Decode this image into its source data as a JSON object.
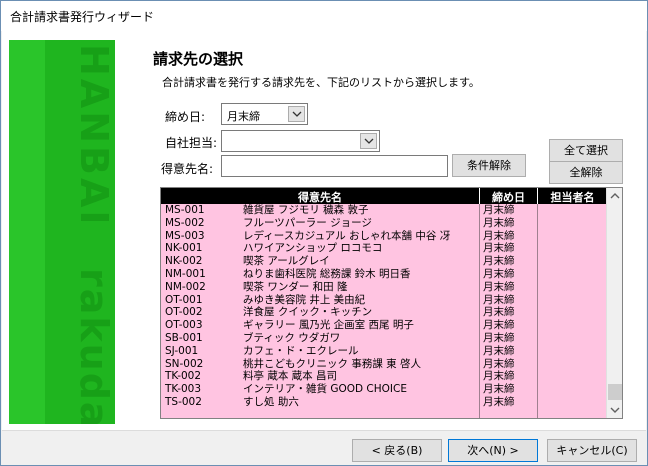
{
  "window": {
    "title": "合計請求書発行ウィザード"
  },
  "banner": {
    "words": [
      "HANBAI",
      "rakuda"
    ]
  },
  "page": {
    "heading": "請求先の選択",
    "description": "合計請求書を発行する請求先を、下記のリストから選択します。"
  },
  "form": {
    "closing_label": "締め日:",
    "closing_value": "月末締",
    "staff_label": "自社担当:",
    "staff_value": "",
    "customer_label": "得意先名:",
    "customer_value": "",
    "clear_condition": "条件解除",
    "select_all": "全て選択",
    "deselect_all": "全解除"
  },
  "list": {
    "columns": [
      "得意先名",
      "締め日",
      "担当者名"
    ],
    "rows": [
      {
        "code": "MS-001",
        "name": "雑貨屋 フジモリ 穢森 敦子",
        "closing": "月末締"
      },
      {
        "code": "MS-002",
        "name": "フルーツパーラー ジョージ",
        "closing": "月末締"
      },
      {
        "code": "MS-003",
        "name": "レディースカジュアル おしゃれ本舗 中谷 冴",
        "closing": "月末締"
      },
      {
        "code": "NK-001",
        "name": "ハワイアンショップ ロコモコ",
        "closing": "月末締"
      },
      {
        "code": "NK-002",
        "name": "喫茶 アールグレイ",
        "closing": "月末締"
      },
      {
        "code": "NM-001",
        "name": "ねりま歯科医院 総務課 鈴木 明日香",
        "closing": "月末締"
      },
      {
        "code": "NM-002",
        "name": "喫茶 ワンダー 和田 隆",
        "closing": "月末締"
      },
      {
        "code": "OT-001",
        "name": "みゆき美容院 井上 美由紀",
        "closing": "月末締"
      },
      {
        "code": "OT-002",
        "name": "洋食屋 クイック・キッチン",
        "closing": "月末締"
      },
      {
        "code": "OT-003",
        "name": "ギャラリー 風乃光 企画室 西尾 明子",
        "closing": "月末締"
      },
      {
        "code": "SB-001",
        "name": "ブティック ウダガワ",
        "closing": "月末締"
      },
      {
        "code": "SJ-001",
        "name": "カフェ・ド・エクレール",
        "closing": "月末締"
      },
      {
        "code": "SN-002",
        "name": "桃井こどもクリニック 事務課 東 啓人",
        "closing": "月末締"
      },
      {
        "code": "TK-002",
        "name": "料亭 蔵本 蔵本 昌司",
        "closing": "月末締"
      },
      {
        "code": "TK-003",
        "name": "インテリア・雑貨 GOOD CHOICE",
        "closing": "月末締"
      },
      {
        "code": "TS-002",
        "name": "すし処 助六",
        "closing": "月末締"
      }
    ]
  },
  "footer": {
    "back": "< 戻る(B)",
    "next": "次へ(N) >",
    "cancel": "キャンセル(C)"
  },
  "colors": {
    "banner": "#1fb51f",
    "list_bg": "#ffc4e1",
    "header_bg": "#000000"
  }
}
